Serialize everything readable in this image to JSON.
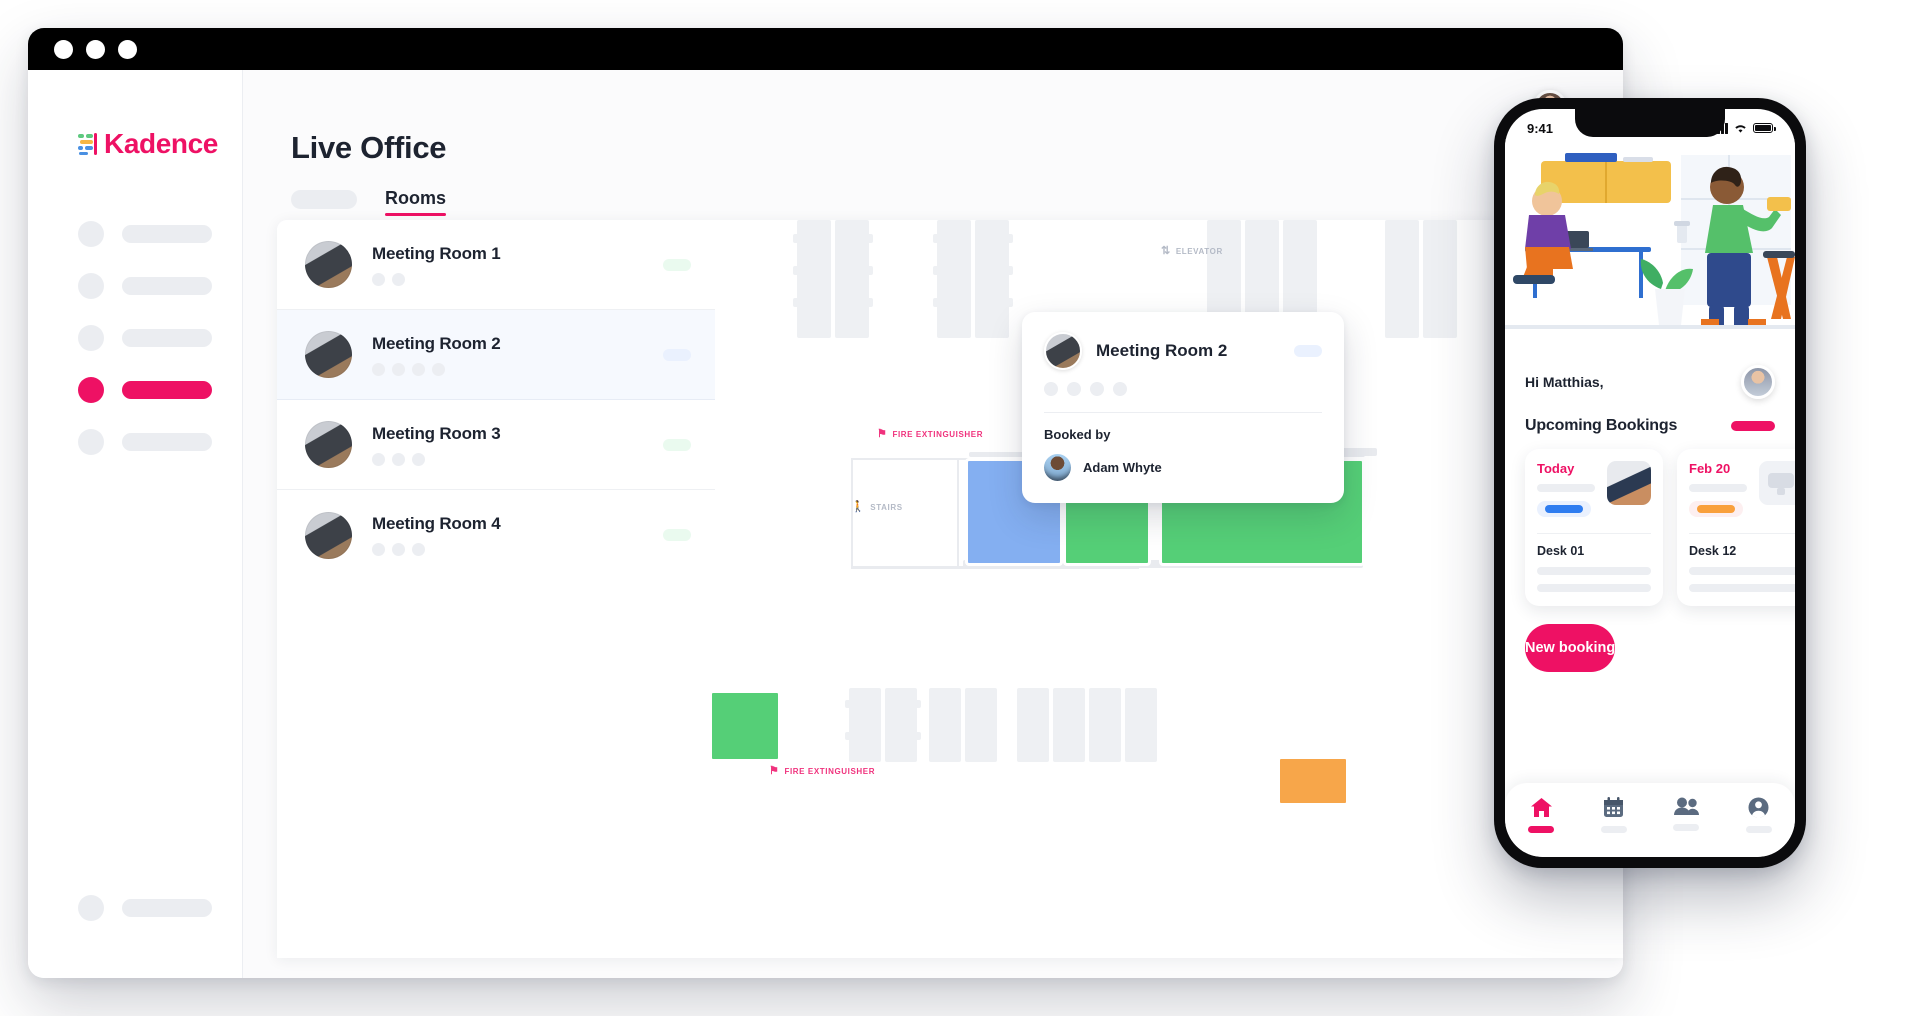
{
  "window": {
    "dots": [
      "close",
      "minimize",
      "maximize"
    ]
  },
  "brand": {
    "name": "Kadence",
    "color": "#EE1164"
  },
  "sidebar": {
    "items": [
      {
        "id": "nav-1",
        "active": false
      },
      {
        "id": "nav-2",
        "active": false
      },
      {
        "id": "nav-3",
        "active": false
      },
      {
        "id": "nav-4",
        "active": true
      },
      {
        "id": "nav-5",
        "active": false
      }
    ],
    "bottom_item": {
      "id": "nav-bottom",
      "active": false
    }
  },
  "header": {
    "title": "Live Office",
    "avatar": "user-avatar"
  },
  "tabs": [
    {
      "label": "",
      "skeleton": true,
      "active": false
    },
    {
      "label": "Rooms",
      "skeleton": false,
      "active": true
    }
  ],
  "rooms": [
    {
      "name": "Meeting Room 1",
      "dots": 2,
      "status_color": "green",
      "selected": false
    },
    {
      "name": "Meeting Room 2",
      "dots": 4,
      "status_color": "blue",
      "selected": true
    },
    {
      "name": "Meeting Room 3",
      "dots": 3,
      "status_color": "green",
      "selected": false
    },
    {
      "name": "Meeting Room 4",
      "dots": 3,
      "status_color": "green",
      "selected": false
    }
  ],
  "floorplan": {
    "labels": [
      {
        "text": "ELEVATOR",
        "icon": "elevator-icon",
        "kind": "grey"
      },
      {
        "text": "STAIRS",
        "icon": "stairs-icon",
        "kind": "grey"
      },
      {
        "text": "FIRE EXTINGUISHER",
        "icon": "fire-extinguisher-icon",
        "kind": "fire"
      },
      {
        "text": "FIRE EXTINGUISHER",
        "icon": "fire-extinguisher-icon",
        "kind": "fire"
      }
    ],
    "colors": {
      "available": "#55cf77",
      "booked": "#84aff1",
      "pending": "#f7a64a"
    }
  },
  "popup": {
    "room_name": "Meeting Room 2",
    "dots": 4,
    "status_color": "blue",
    "booked_by_label": "Booked by",
    "person": {
      "name": "Adam Whyte",
      "avatar": "person-avatar"
    }
  },
  "phone": {
    "status": {
      "time": "9:41",
      "signal": "cellular-icon",
      "wifi": "wifi-icon",
      "battery": "battery-icon"
    },
    "greeting": "Hi Matthias,",
    "section_title": "Upcoming Bookings",
    "bookings": [
      {
        "date": "Today",
        "desk": "Desk 01",
        "pill_color": "blue",
        "thumb": "photo"
      },
      {
        "date": "Feb 20",
        "desk": "Desk 12",
        "pill_color": "orange",
        "thumb": "grey"
      }
    ],
    "cta": "New booking",
    "tabbar": [
      {
        "name": "home-icon",
        "active": true
      },
      {
        "name": "calendar-icon",
        "active": false
      },
      {
        "name": "people-icon",
        "active": false
      },
      {
        "name": "profile-icon",
        "active": false
      }
    ]
  }
}
